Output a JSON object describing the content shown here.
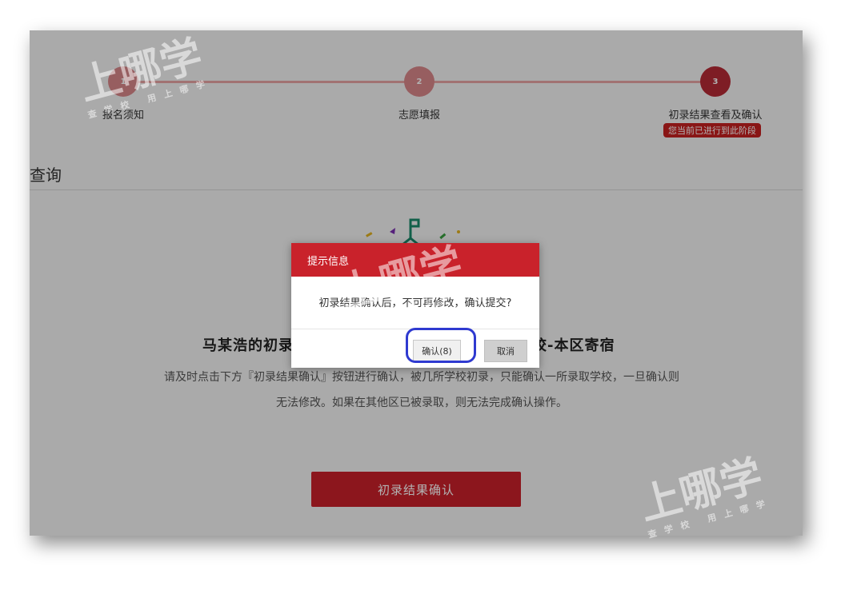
{
  "steps": [
    {
      "number": "1",
      "label": "报名须知"
    },
    {
      "number": "2",
      "label": "志愿填报"
    },
    {
      "number": "3",
      "label": "初录结果查看及确认",
      "badge": "您当前已进行到此阶段"
    }
  ],
  "section": {
    "title": "查询"
  },
  "result": {
    "title_left": "马某浩的初录",
    "title_right": "校-本区寄宿",
    "hint_line1": "请及时点击下方『初录结果确认』按钮进行确认，被几所学校初录，只能确认一所录取学校，一旦确认则",
    "hint_line2": "无法修改。如果在其他区已被录取，则无法完成确认操作。",
    "confirm_button": "初录结果确认"
  },
  "modal": {
    "title": "提示信息",
    "message": "初录结果确认后，不可再修改，确认提交?",
    "ok_label": "确认(8)",
    "cancel_label": "取消"
  },
  "watermark": {
    "text": "上哪学",
    "sub": "查学校 用上哪学"
  },
  "colors": {
    "primary": "#c9222b",
    "step_active": "#b52a35",
    "step_done": "#d9878a",
    "highlight": "#2f3ad0"
  }
}
